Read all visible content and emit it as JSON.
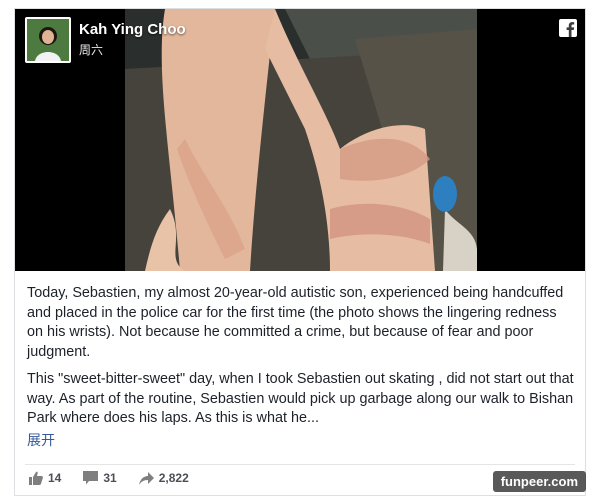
{
  "post": {
    "author": "Kah Ying Choo",
    "date": "周六",
    "paragraph_1": "Today, Sebastien, my almost 20-year-old autistic son, experienced being handcuffed and placed in the police car for the first time (the photo shows the lingering redness on his wrists). Not because he committed a crime, but because of fear and poor judgment.",
    "paragraph_2": "This \"sweet-bitter-sweet\" day, when I took Sebastien out skating , did not start out that way. As part of the routine, Sebastien would pick up garbage along our walk to Bishan Park where does his laps. As this is what he...",
    "see_more": "展开"
  },
  "stats": {
    "likes": "14",
    "comments": "31",
    "shares": "2,822"
  },
  "icons": {
    "brand": "facebook-icon",
    "like": "thumbs-up-icon",
    "comment": "comment-bubble-icon",
    "share": "share-arrow-icon"
  },
  "watermark": "funpeer.com",
  "colors": {
    "link": "#365899",
    "text": "#1d2129",
    "stat_text": "#4b4f56"
  }
}
